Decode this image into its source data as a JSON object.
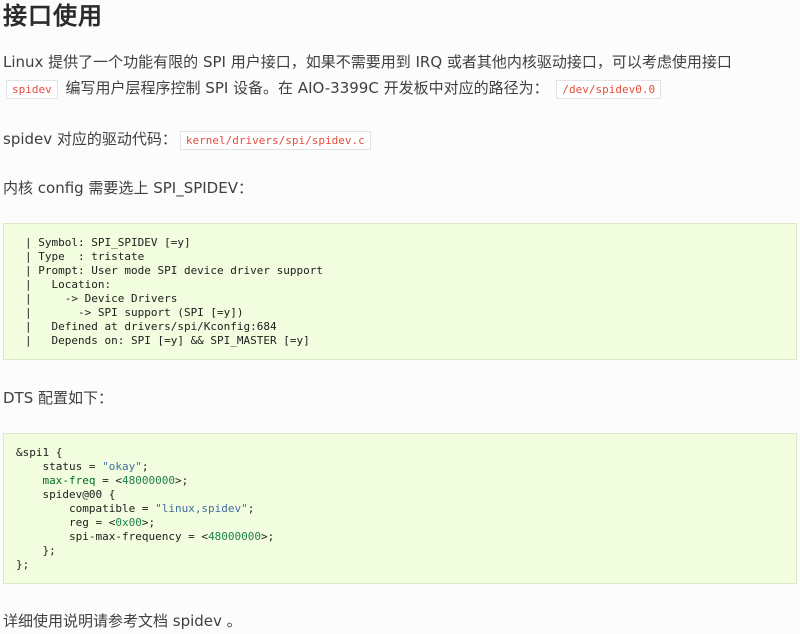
{
  "heading": "接口使用",
  "para1": {
    "text_a": "Linux 提供了一个功能有限的 SPI 用户接口，如果不需要用到 IRQ 或者其他内核驱动接口，可以考虑使用接口",
    "code_a": "spidev",
    "text_b": "编写用户层程序控制 SPI 设备。在 AIO-3399C 开发板中对应的路径为：",
    "code_b": "/dev/spidev0.0"
  },
  "para2": {
    "text": "spidev 对应的驱动代码：",
    "code": "kernel/drivers/spi/spidev.c"
  },
  "para3": "内核 config 需要选上 SPI_SPIDEV：",
  "kconfig_lines": [
    "| Symbol: SPI_SPIDEV [=y]",
    "| Type  : tristate",
    "| Prompt: User mode SPI device driver support",
    "|   Location:",
    "|     -> Device Drivers",
    "|       -> SPI support (SPI [=y])",
    "|   Defined at drivers/spi/Kconfig:684",
    "|   Depends on: SPI [=y] && SPI_MASTER [=y]"
  ],
  "para4": "DTS 配置如下：",
  "dts": {
    "l1": "&spi1 {",
    "l2_key": "    status = ",
    "l2_val": "\"okay\"",
    "l2_end": ";",
    "l3_key": "    max-freq",
    "l3_mid": " = <",
    "l3_val": "48000000",
    "l3_end": ">;",
    "l4": "    spidev@00 {",
    "l5_key": "        compatible = ",
    "l5_val": "\"linux,spidev\"",
    "l5_end": ";",
    "l6_key": "        reg = <",
    "l6_val": "0x00",
    "l6_end": ">;",
    "l7_key": "        spi-max-frequency = <",
    "l7_val": "48000000",
    "l7_end": ">;",
    "l8": "    };",
    "l9": "};"
  },
  "para5": "详细使用说明请参考文档 spidev 。"
}
